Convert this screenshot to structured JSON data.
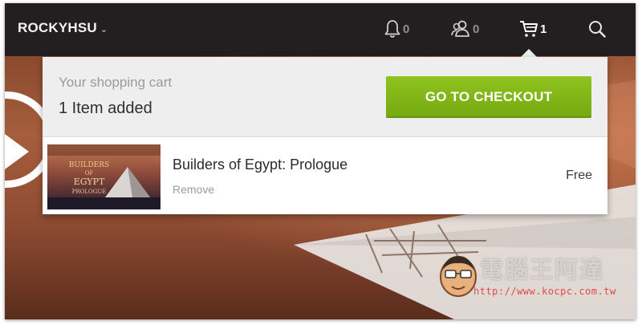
{
  "topbar": {
    "username": "ROCKYHSU",
    "notifications": {
      "icon": "bell-icon",
      "count": "0"
    },
    "friends": {
      "icon": "friends-icon",
      "count": "0"
    },
    "cart": {
      "icon": "cart-icon",
      "count": "1"
    },
    "search": {
      "icon": "search-icon"
    }
  },
  "cart_dropdown": {
    "title": "Your shopping cart",
    "status": "1 Item added",
    "checkout_label": "GO TO CHECKOUT",
    "items": [
      {
        "name": "Builders of Egypt: Prologue",
        "remove_label": "Remove",
        "price": "Free",
        "thumbnail": {
          "title_line1": "BUILDERS",
          "title_line2": "OF",
          "title_line3": "EGYPT",
          "subtitle": "PROLOGUE"
        }
      }
    ]
  },
  "watermark": {
    "text": "電腦王阿達",
    "url": "http://www.kocpc.com.tw"
  },
  "colors": {
    "topbar_bg": "#231f20",
    "checkout_green": "#86bb19",
    "panel_head_bg": "#eeeeee"
  }
}
